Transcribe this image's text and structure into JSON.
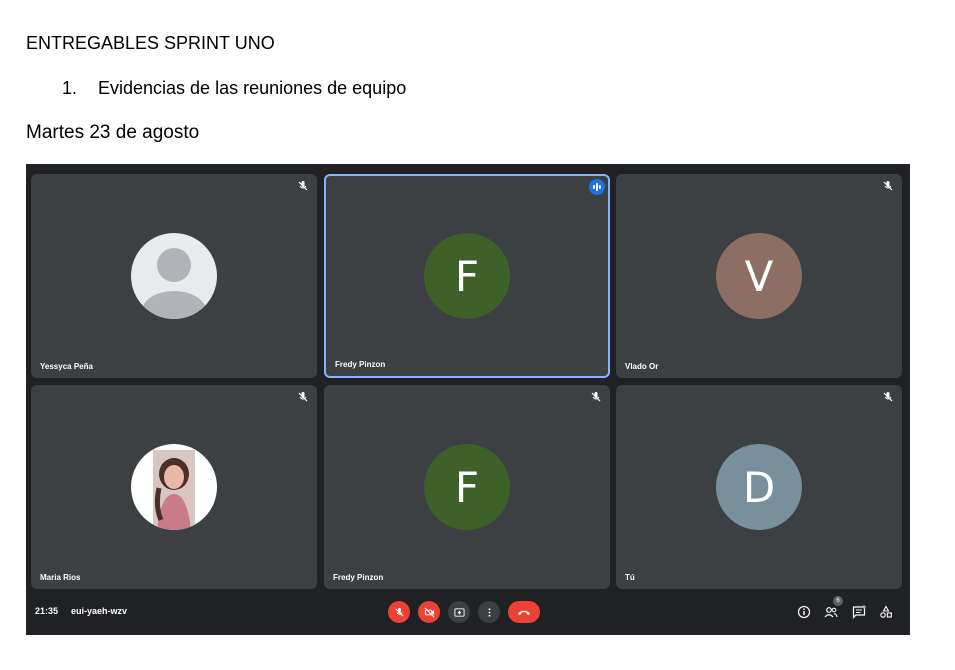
{
  "document": {
    "heading": "ENTREGABLES SPRINT UNO",
    "list_number": "1.",
    "list_item": "Evidencias de las reuniones de equipo",
    "date": "Martes 23 de agosto"
  },
  "meeting": {
    "participants": [
      {
        "name": "Yessyca Peña",
        "avatar": "default-person",
        "muted": true
      },
      {
        "name": "Fredy Pinzon",
        "avatar_letter": "F",
        "avatar_color": "#3d6128",
        "speaking": true
      },
      {
        "name": "Vlado Or",
        "avatar_letter": "V",
        "avatar_color": "#8d6e63",
        "muted": true
      },
      {
        "name": "Maria Rios",
        "avatar": "photo",
        "muted": true
      },
      {
        "name": "Fredy Pinzon",
        "avatar_letter": "F",
        "avatar_color": "#3d6128",
        "muted": true
      },
      {
        "name": "Tú",
        "avatar_letter": "D",
        "avatar_color": "#78909c",
        "muted": true
      }
    ],
    "toolbar": {
      "time": "21:35",
      "meeting_code": "eui-yaeh-wzv",
      "people_count": "6",
      "controls": [
        "mic-off-icon",
        "camera-off-icon",
        "present-screen-icon",
        "more-options-icon",
        "end-call-icon"
      ],
      "right_icons": [
        "info-icon",
        "people-icon",
        "chat-icon",
        "activities-icon"
      ],
      "colors": {
        "danger": "#ea4335",
        "control": "#3c4043",
        "active_border": "#8ab4f8",
        "speaking": "#1a73e8"
      }
    }
  }
}
